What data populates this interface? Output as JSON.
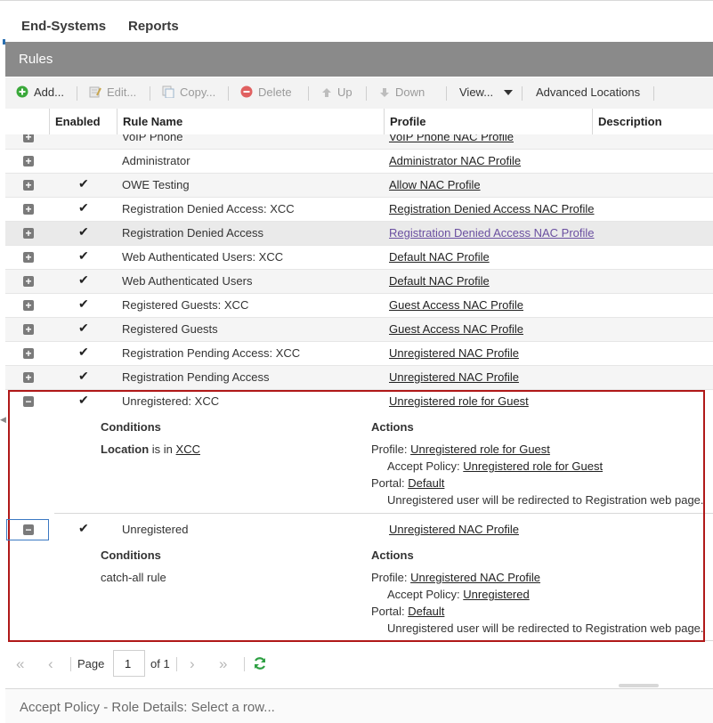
{
  "nav": {
    "tabs": [
      "End-Systems",
      "Reports"
    ]
  },
  "panel": {
    "title": "Rules"
  },
  "toolbar": {
    "add": "Add...",
    "edit": "Edit...",
    "copy": "Copy...",
    "delete": "Delete",
    "up": "Up",
    "down": "Down",
    "view": "View...",
    "advanced_locations": "Advanced Locations"
  },
  "columns": {
    "enabled": "Enabled",
    "rule_name": "Rule Name",
    "profile": "Profile",
    "description": "Description"
  },
  "rows": [
    {
      "name": "VoIP Phone",
      "enabled": false,
      "profile": "VoIP Phone NAC Profile"
    },
    {
      "name": "Administrator",
      "enabled": false,
      "profile": "Administrator NAC Profile"
    },
    {
      "name": "OWE Testing",
      "enabled": true,
      "profile": "Allow NAC Profile"
    },
    {
      "name": "Registration Denied Access: XCC",
      "enabled": true,
      "profile": "Registration Denied Access NAC Profile"
    },
    {
      "name": "Registration Denied Access",
      "enabled": true,
      "profile": "Registration Denied Access NAC Profile"
    },
    {
      "name": "Web Authenticated Users: XCC",
      "enabled": true,
      "profile": "Default NAC Profile"
    },
    {
      "name": "Web Authenticated Users",
      "enabled": true,
      "profile": "Default NAC Profile"
    },
    {
      "name": "Registered Guests: XCC",
      "enabled": true,
      "profile": "Guest Access NAC Profile"
    },
    {
      "name": "Registered Guests",
      "enabled": true,
      "profile": "Guest Access NAC Profile"
    },
    {
      "name": "Registration Pending Access: XCC",
      "enabled": true,
      "profile": "Unregistered NAC Profile"
    },
    {
      "name": "Registration Pending Access",
      "enabled": true,
      "profile": "Unregistered NAC Profile"
    }
  ],
  "check_mark": "✔",
  "expanded": [
    {
      "name": "Unregistered: XCC",
      "enabled": true,
      "profile": "Unregistered role for Guest",
      "conditions_label": "Conditions",
      "condition_key": "Location",
      "condition_op": "is in",
      "condition_value": "XCC",
      "actions_label": "Actions",
      "profile_label": "Profile:",
      "profile_value": "Unregistered role for Guest",
      "accept_policy_label": "Accept Policy:",
      "accept_policy_value": "Unregistered role for Guest",
      "portal_label": "Portal:",
      "portal_value": "Default",
      "redirect_note": "Unregistered user will be redirected to Registration web page."
    },
    {
      "name": "Unregistered",
      "enabled": true,
      "profile": "Unregistered NAC Profile",
      "conditions_label": "Conditions",
      "condition_text": "catch-all rule",
      "actions_label": "Actions",
      "profile_label": "Profile:",
      "profile_value": "Unregistered NAC Profile",
      "accept_policy_label": "Accept Policy:",
      "accept_policy_value": "Unregistered",
      "portal_label": "Portal:",
      "portal_value": "Default",
      "redirect_note": "Unregistered user will be redirected to Registration web page."
    }
  ],
  "pager": {
    "page_label": "Page",
    "page_value": "1",
    "of_label": "of 1"
  },
  "status_bar": {
    "text": "Accept Policy - Role Details: Select a row..."
  },
  "colors": {
    "header_gray": "#8a8a8a",
    "highlight_red": "#b01818",
    "add_green": "#3aa83a",
    "delete_red": "#e06060",
    "refresh_green": "#2ea043"
  }
}
